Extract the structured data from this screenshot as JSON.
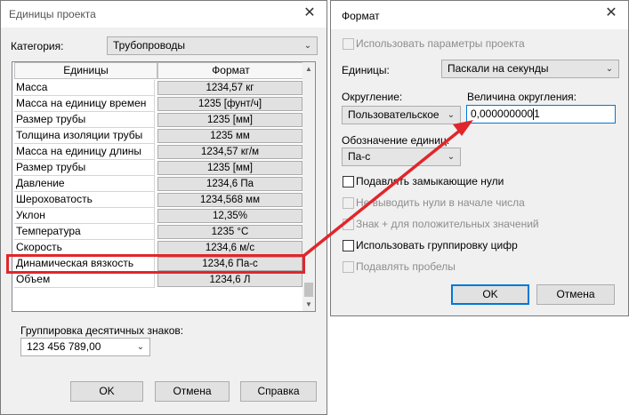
{
  "units_dialog": {
    "title": "Единицы проекта",
    "category_label": "Категория:",
    "category_value": "Трубопроводы",
    "table": {
      "headers": [
        "Единицы",
        "Формат"
      ],
      "rows": [
        {
          "name": "Масса",
          "format": "1234,57 кг"
        },
        {
          "name": "Масса на единицу времен",
          "format": "1235 [фунт/ч]"
        },
        {
          "name": "Размер трубы",
          "format": "1235 [мм]"
        },
        {
          "name": "Толщина изоляции трубы",
          "format": "1235 мм"
        },
        {
          "name": "Масса на единицу длины",
          "format": "1234,57 кг/м"
        },
        {
          "name": "Размер трубы",
          "format": "1235 [мм]"
        },
        {
          "name": "Давление",
          "format": "1234,6 Па"
        },
        {
          "name": "Шероховатость",
          "format": "1234,568 мм"
        },
        {
          "name": "Уклон",
          "format": "12,35%"
        },
        {
          "name": "Температура",
          "format": "1235 °C"
        },
        {
          "name": "Скорость",
          "format": "1234,6 м/с"
        },
        {
          "name": "Динамическая вязкость",
          "format": "1234,6 Па-с"
        },
        {
          "name": "Объем",
          "format": "1234,6 Л"
        }
      ]
    },
    "grouping_label": "Группировка десятичных знаков:",
    "grouping_value": "123 456 789,00",
    "buttons": {
      "ok": "OK",
      "cancel": "Отмена",
      "help": "Справка"
    }
  },
  "format_dialog": {
    "title": "Формат",
    "use_project_settings": "Использовать параметры проекта",
    "units_label": "Единицы:",
    "units_value": "Паскали на секунды",
    "rounding_label": "Округление:",
    "rounding_value": "Пользовательское",
    "rounding_increment_label": "Величина округления:",
    "rounding_increment_value": "0,000000000",
    "rounding_increment_tail": "1",
    "unit_symbol_label": "Обозначение единиц:",
    "unit_symbol_value": "Па-с",
    "options": [
      {
        "label": "Подавлять замыкающие нули",
        "enabled": true,
        "checked": false
      },
      {
        "label": "Не выводить нули в начале числа",
        "enabled": false,
        "checked": false
      },
      {
        "label": "Знак + для положительных значений",
        "enabled": false,
        "checked": false
      },
      {
        "label": "Использовать группировку цифр",
        "enabled": true,
        "checked": false
      },
      {
        "label": "Подавлять пробелы",
        "enabled": false,
        "checked": false
      }
    ],
    "buttons": {
      "ok": "OK",
      "cancel": "Отмена"
    }
  },
  "icons": {
    "close": "close-icon",
    "dropdown": "chevron-down-icon"
  },
  "colors": {
    "highlight": "#e0262c",
    "focus": "#0078d7"
  }
}
